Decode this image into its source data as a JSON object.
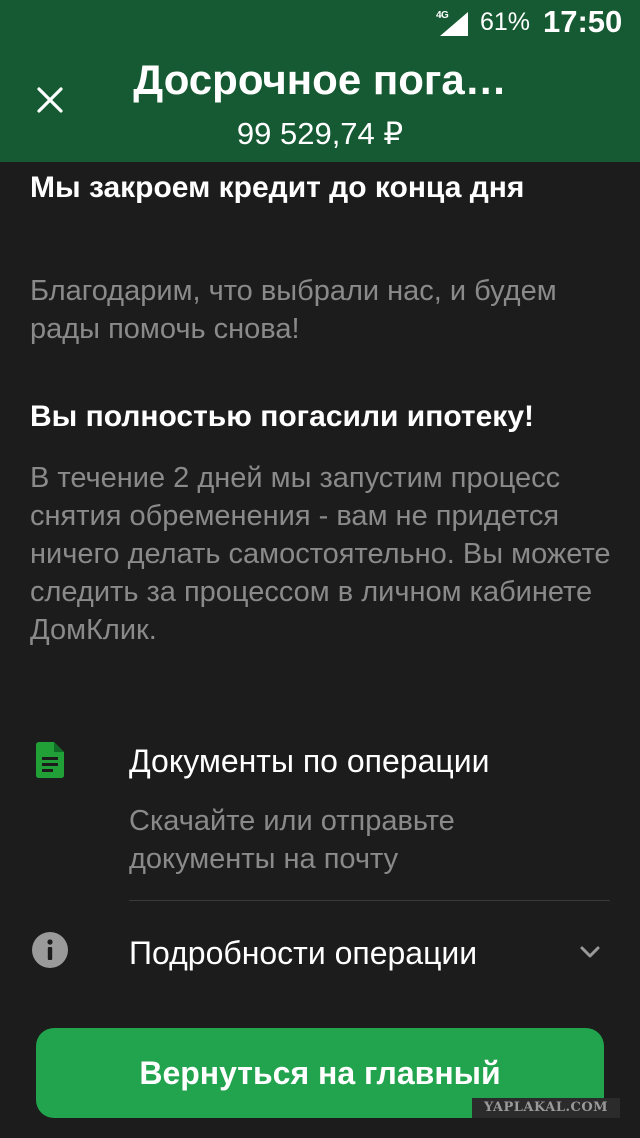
{
  "status_bar": {
    "network": "4G",
    "battery": "61%",
    "time": "17:50",
    "bar_color": "#155a32"
  },
  "header": {
    "close_icon": "close-icon",
    "title": "Досрочное пога…",
    "amount": "99 529,74 ₽"
  },
  "main": {
    "heading1": "Мы закроем кредит до конца дня",
    "text1": "Благодарим, что выбрали нас, и будем рады помочь снова!",
    "heading2": "Вы полностью погасили ипотеку!",
    "text2": "В течение 2 дней мы запустим процесс снятия обременения - вам не придется ничего делать самостоятельно. Вы можете следить за процессом в личном кабинете ДомКлик."
  },
  "documents": {
    "icon": "document-icon",
    "title": "Документы по операции",
    "subtitle": "Скачайте или отправьте документы на почту",
    "accent": "#21a038"
  },
  "details": {
    "icon": "info-icon",
    "title": "Подробности операции",
    "chevron": "chevron-down-icon"
  },
  "button": {
    "label": "Вернуться на главный",
    "color": "#22a34d"
  },
  "watermark": "YAPLAKAL.COM"
}
